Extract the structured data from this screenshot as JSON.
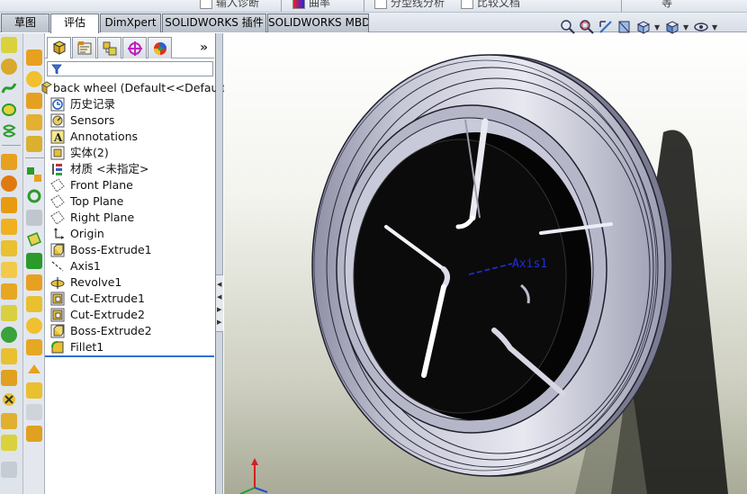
{
  "top_ribbon": {
    "items": [
      "输入诊断",
      "曲率",
      "分型线分析",
      "比较文档",
      "等"
    ]
  },
  "tabs": [
    "草图",
    "评估",
    "DimXpert",
    "SOLIDWORKS 插件",
    "SOLIDWORKS MBD"
  ],
  "active_tab": "评估",
  "view_toolbar": {
    "icons": [
      "zoom-to-fit-icon",
      "zoom-to-area-icon",
      "previous-view-icon",
      "section-view-icon",
      "view-orientation-icon",
      "display-style-icon",
      "hide-show-items-icon"
    ]
  },
  "feature_manager": {
    "tabs": [
      "featuremanager-tab",
      "propertymanager-tab",
      "configurationmanager-tab",
      "dimxpertmanager-tab",
      "displaymanager-tab"
    ],
    "more_label": "»",
    "root": "back wheel  (Default<<Default",
    "items": [
      {
        "label": "历史记录",
        "icon": "history-icon"
      },
      {
        "label": "Sensors",
        "icon": "sensors-icon"
      },
      {
        "label": "Annotations",
        "icon": "annotations-icon"
      },
      {
        "label": "实体(2)",
        "icon": "solid-bodies-icon"
      },
      {
        "label": "材质 <未指定>",
        "icon": "material-icon"
      },
      {
        "label": "Front Plane",
        "icon": "plane-icon"
      },
      {
        "label": "Top Plane",
        "icon": "plane-icon"
      },
      {
        "label": "Right Plane",
        "icon": "plane-icon"
      },
      {
        "label": "Origin",
        "icon": "origin-icon"
      },
      {
        "label": "Boss-Extrude1",
        "icon": "extrude-icon"
      },
      {
        "label": "Axis1",
        "icon": "axis-icon"
      },
      {
        "label": "Revolve1",
        "icon": "revolve-icon"
      },
      {
        "label": "Cut-Extrude1",
        "icon": "cut-extrude-icon"
      },
      {
        "label": "Cut-Extrude2",
        "icon": "cut-extrude-icon"
      },
      {
        "label": "Boss-Extrude2",
        "icon": "extrude-icon"
      },
      {
        "label": "Fillet1",
        "icon": "fillet-icon"
      }
    ]
  },
  "graphics": {
    "axis_label": "Axis1"
  },
  "colors": {
    "tire": "#c9cad8",
    "rim_black": "#050505",
    "axis_blue": "#1f2fd6",
    "rollback_bar": "#2f6fd0"
  }
}
